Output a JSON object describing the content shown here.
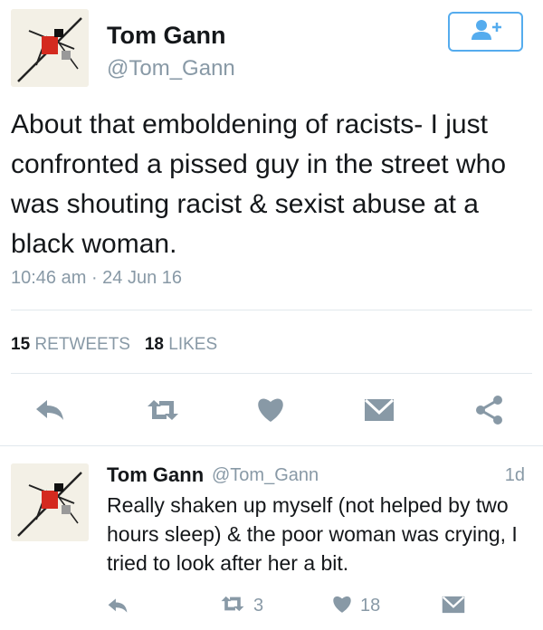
{
  "tweet": {
    "author_name": "Tom Gann",
    "author_handle": "@Tom_Gann",
    "text": "About that emboldening of racists- I just confronted a pissed guy in the street who was shouting racist & sexist abuse at a black woman.",
    "timestamp": "10:46 am · 24 Jun 16",
    "retweets_count": "15",
    "retweets_label": "RETWEETS",
    "likes_count": "18",
    "likes_label": "LIKES"
  },
  "reply": {
    "author_name": "Tom Gann",
    "author_handle": "@Tom_Gann",
    "age": "1d",
    "text": "Really shaken up myself (not helped by two hours sleep) & the poor woman was crying, I tried to look after her a bit.",
    "retweets_count": "3",
    "likes_count": "18"
  },
  "colors": {
    "accent": "#55acee",
    "icon_gray": "#8899a6",
    "text": "#14171a"
  },
  "icons": [
    "reply-icon",
    "retweet-icon",
    "heart-icon",
    "dm-icon",
    "share-icon",
    "follow-icon"
  ]
}
